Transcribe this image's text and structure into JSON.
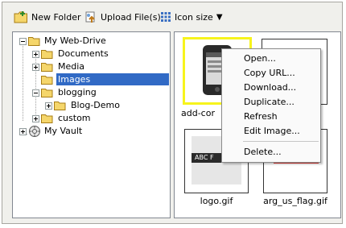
{
  "toolbar": {
    "new_folder": "New Folder",
    "upload_files": "Upload File(s)",
    "icon_size": "Icon size",
    "icon_size_arrow": "▼"
  },
  "tree": {
    "root": "My Web-Drive",
    "documents": "Documents",
    "media": "Media",
    "images": "Images",
    "blogging": "blogging",
    "blog_demo": "Blog-Demo",
    "custom": "custom",
    "vault": "My Vault"
  },
  "files": {
    "file1": "add-cor",
    "file2": "logo.gif",
    "file3": "arg_us_flag.gif",
    "logo_text": "ABC F"
  },
  "context_menu": {
    "open": "Open...",
    "copy_url": "Copy URL...",
    "download": "Download...",
    "duplicate": "Duplicate...",
    "refresh": "Refresh",
    "edit_image": "Edit Image...",
    "delete": "Delete..."
  },
  "colors": {
    "selection": "#316ac5",
    "thumb_highlight": "#f7f41c",
    "folder": "#f5d66b",
    "flag_red": "#e53935"
  }
}
